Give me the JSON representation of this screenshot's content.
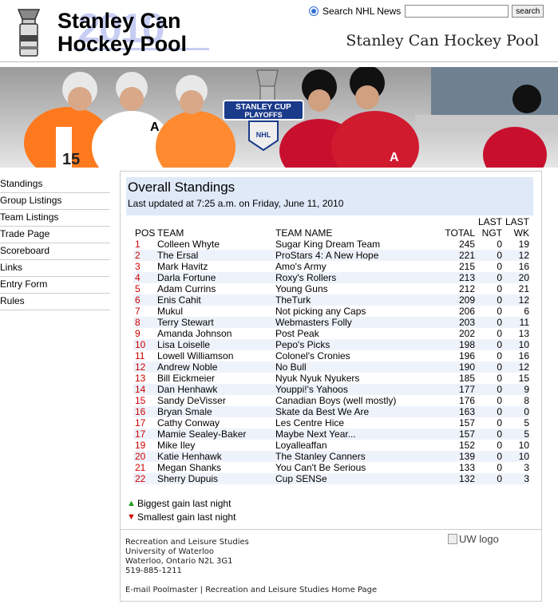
{
  "header": {
    "logo_line1": "Stanley Can",
    "logo_line2": "Hockey Pool",
    "logo_year": "2010",
    "site_title": "Stanley Can Hockey Pool"
  },
  "search": {
    "radio_label": "Search NHL News",
    "button_label": "search",
    "query": ""
  },
  "banner": {
    "cup_logo_line1": "STANLEY CUP",
    "cup_logo_line2": "PLAYOFFS",
    "cup_logo_badge": "NHL",
    "jersey_number": "15",
    "jersey_letter_a1": "A",
    "jersey_letter_a2": "A"
  },
  "sidebar": {
    "items": [
      {
        "label": "Standings"
      },
      {
        "label": "Group Listings"
      },
      {
        "label": "Team Listings"
      },
      {
        "label": "Trade Page"
      },
      {
        "label": "Scoreboard"
      },
      {
        "label": "Links"
      },
      {
        "label": "Entry Form"
      },
      {
        "label": "Rules"
      }
    ]
  },
  "standings": {
    "title": "Overall Standings",
    "updated": "Last updated at 7:25 a.m. on Friday, June 11, 2010",
    "columns": {
      "pos": "POS",
      "team": "TEAM",
      "team_name": "TEAM NAME",
      "total": "TOTAL",
      "last_ngt_top": "LAST",
      "last_ngt_bottom": "NGT",
      "last_wk_top": "LAST",
      "last_wk_bottom": "WK"
    },
    "rows": [
      {
        "pos": "1",
        "team": "Colleen Whyte",
        "team_name": "Sugar King Dream Team",
        "total": "245",
        "ngt": "0",
        "wk": "19"
      },
      {
        "pos": "2",
        "team": "The Ersal",
        "team_name": "ProStars 4: A New Hope",
        "total": "221",
        "ngt": "0",
        "wk": "12"
      },
      {
        "pos": "3",
        "team": "Mark Havitz",
        "team_name": "Amo's Army",
        "total": "215",
        "ngt": "0",
        "wk": "16"
      },
      {
        "pos": "4",
        "team": "Darla Fortune",
        "team_name": "Roxy's Rollers",
        "total": "213",
        "ngt": "0",
        "wk": "20"
      },
      {
        "pos": "5",
        "team": "Adam Currins",
        "team_name": "Young Guns",
        "total": "212",
        "ngt": "0",
        "wk": "21"
      },
      {
        "pos": "6",
        "team": "Enis Cahit",
        "team_name": "TheTurk",
        "total": "209",
        "ngt": "0",
        "wk": "12"
      },
      {
        "pos": "7",
        "team": "Mukul",
        "team_name": "Not picking any Caps",
        "total": "206",
        "ngt": "0",
        "wk": "6"
      },
      {
        "pos": "8",
        "team": "Terry Stewart",
        "team_name": "Webmasters Folly",
        "total": "203",
        "ngt": "0",
        "wk": "11"
      },
      {
        "pos": "9",
        "team": "Amanda Johnson",
        "team_name": "Post Peak",
        "total": "202",
        "ngt": "0",
        "wk": "13"
      },
      {
        "pos": "10",
        "team": "Lisa Loiselle",
        "team_name": "Pepo's Picks",
        "total": "198",
        "ngt": "0",
        "wk": "10"
      },
      {
        "pos": "11",
        "team": "Lowell Williamson",
        "team_name": "Colonel's Cronies",
        "total": "196",
        "ngt": "0",
        "wk": "16"
      },
      {
        "pos": "12",
        "team": "Andrew Noble",
        "team_name": "No Bull",
        "total": "190",
        "ngt": "0",
        "wk": "12"
      },
      {
        "pos": "13",
        "team": "Bill Eickmeier",
        "team_name": "Nyuk Nyuk Nyukers",
        "total": "185",
        "ngt": "0",
        "wk": "15"
      },
      {
        "pos": "14",
        "team": "Dan Henhawk",
        "team_name": "Youppi!'s Yahoos",
        "total": "177",
        "ngt": "0",
        "wk": "9"
      },
      {
        "pos": "15",
        "team": "Sandy DeVisser",
        "team_name": "Canadian Boys (well mostly)",
        "total": "176",
        "ngt": "0",
        "wk": "8"
      },
      {
        "pos": "16",
        "team": "Bryan Smale",
        "team_name": "Skate da Best We Are",
        "total": "163",
        "ngt": "0",
        "wk": "0"
      },
      {
        "pos": "17",
        "team": "Cathy Conway",
        "team_name": "Les Centre Hice",
        "total": "157",
        "ngt": "0",
        "wk": "5"
      },
      {
        "pos": "17",
        "team": "Mamie Sealey-Baker",
        "team_name": "Maybe Next Year...",
        "total": "157",
        "ngt": "0",
        "wk": "5"
      },
      {
        "pos": "19",
        "team": "Mike Iley",
        "team_name": "Loyalleaffan",
        "total": "152",
        "ngt": "0",
        "wk": "10"
      },
      {
        "pos": "20",
        "team": "Katie Henhawk",
        "team_name": "The Stanley Canners",
        "total": "139",
        "ngt": "0",
        "wk": "10"
      },
      {
        "pos": "21",
        "team": "Megan Shanks",
        "team_name": "You Can't Be Serious",
        "total": "133",
        "ngt": "0",
        "wk": "3"
      },
      {
        "pos": "22",
        "team": "Sherry Dupuis",
        "team_name": "Cup SENSe",
        "total": "132",
        "ngt": "0",
        "wk": "3"
      }
    ],
    "legend": {
      "gain": "Biggest gain last night",
      "loss": "Smallest gain last night",
      "gain_color": "#1a9a1a",
      "loss_color": "#d01010"
    }
  },
  "footer": {
    "address_lines": [
      "Recreation and Leisure Studies",
      "University of Waterloo",
      "Waterloo, Ontario N2L 3G1",
      "519-885-1211"
    ],
    "uw_logo_alt": "UW logo",
    "email_link": "E-mail Poolmaster",
    "separator": "|",
    "home_link": "Recreation and Leisure Studies Home Page"
  }
}
